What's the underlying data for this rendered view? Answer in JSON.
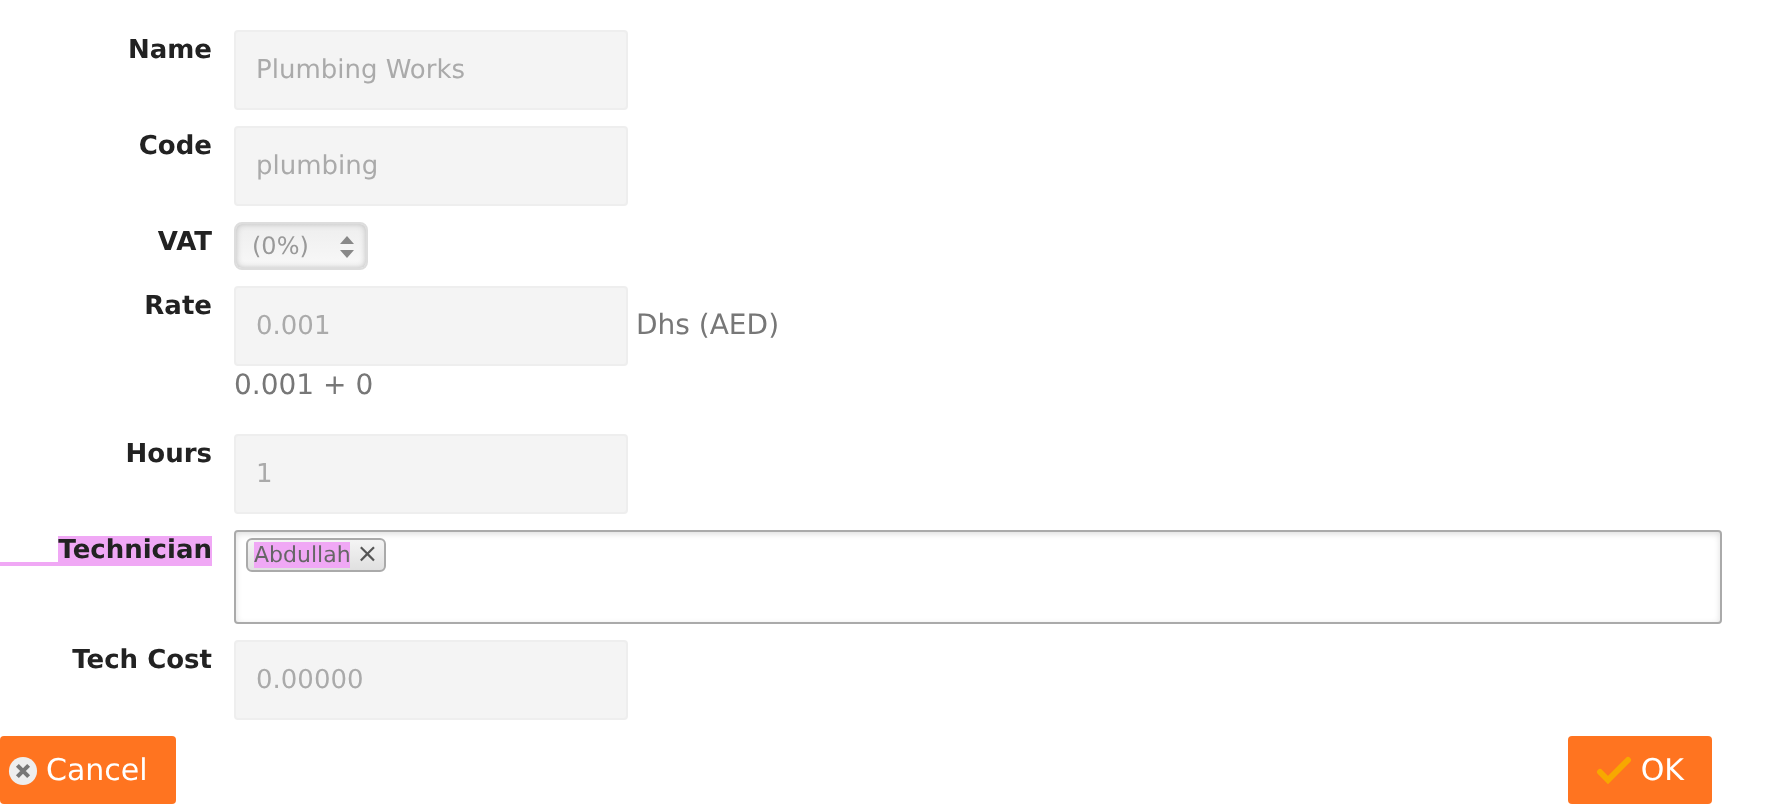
{
  "fields": [
    {
      "kind": "text",
      "label": "Name",
      "value": "Plumbing Works",
      "highlighted": false
    },
    {
      "kind": "text",
      "label": "Code",
      "value": "plumbing",
      "highlighted": false
    },
    {
      "kind": "select",
      "label": "VAT",
      "value": "(0%)",
      "highlighted": false
    },
    {
      "kind": "text",
      "label": "Rate",
      "value": "0.001",
      "unit": "Dhs (AED)",
      "note": "0.001 + 0",
      "highlighted": false
    },
    {
      "kind": "text",
      "label": "Hours",
      "value": "1",
      "highlighted": false
    },
    {
      "kind": "tags",
      "label": "Technician",
      "highlighted": true,
      "tags": [
        {
          "text": "Abdullah",
          "highlighted": true,
          "remove": "×"
        }
      ]
    },
    {
      "kind": "text",
      "label": "Tech Cost",
      "value": "0.00000",
      "highlighted": false
    }
  ],
  "buttons": [
    {
      "kind": "cancel",
      "label": "Cancel"
    },
    {
      "kind": "ok",
      "label": "OK"
    }
  ]
}
